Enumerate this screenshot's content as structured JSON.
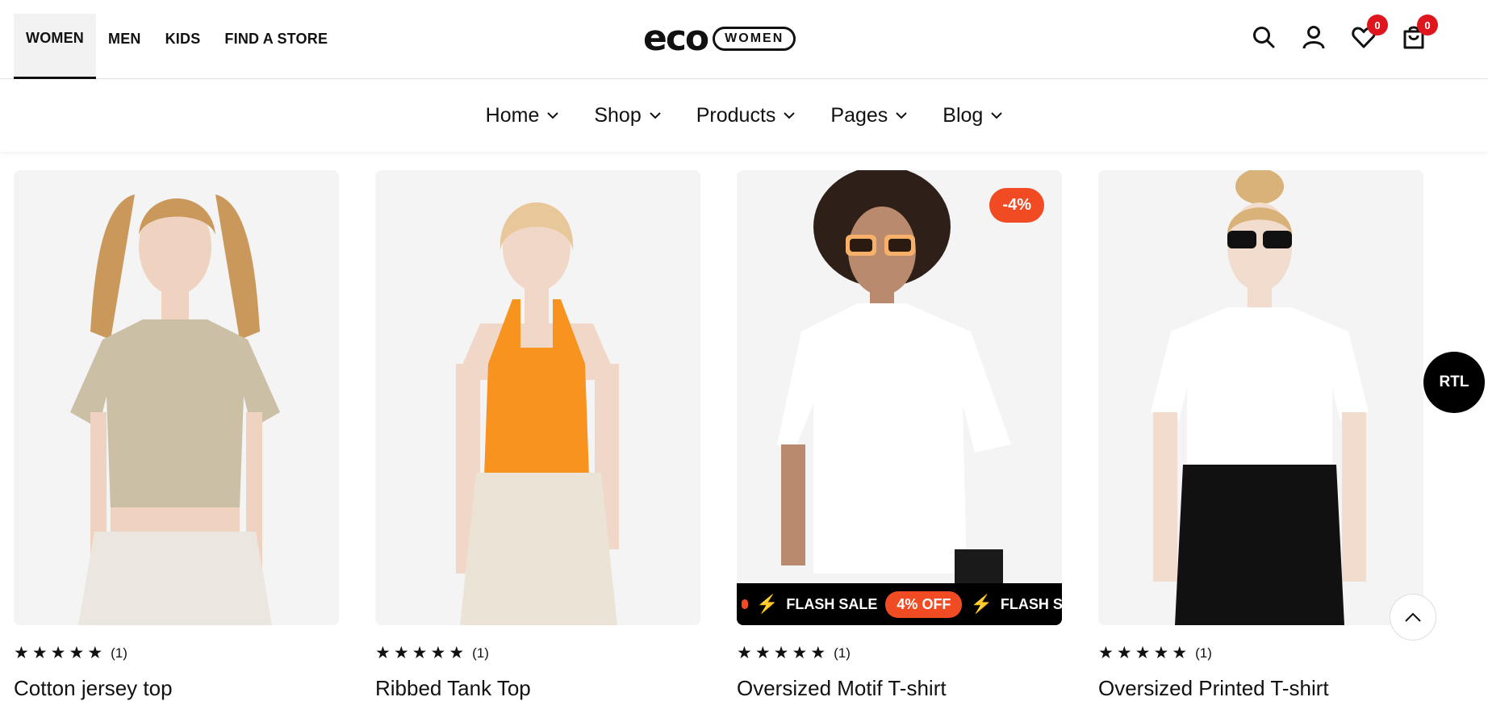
{
  "header": {
    "categories": [
      {
        "label": "WOMEN",
        "active": true
      },
      {
        "label": "MEN"
      },
      {
        "label": "KIDS"
      },
      {
        "label": "FIND A STORE"
      }
    ],
    "logo": {
      "text": "eco",
      "pill": "WOMEN"
    },
    "wishlist_count": "0",
    "cart_count": "0"
  },
  "nav": {
    "items": [
      "Home",
      "Shop",
      "Products",
      "Pages",
      "Blog"
    ]
  },
  "products": [
    {
      "name": "Cotton jersey top",
      "rating": 5,
      "reviews": "(1)",
      "shirt_color": "#cbbfa6",
      "pants_color": "#ebe7e0"
    },
    {
      "name": "Ribbed Tank Top",
      "rating": 5,
      "reviews": "(1)",
      "shirt_color": "#f7931e",
      "pants_color": "#ebe4d6"
    },
    {
      "name": "Oversized Motif T-shirt",
      "rating": 5,
      "reviews": "(1)",
      "discount": "-4%",
      "flash_label": "FLASH SALE",
      "flash_off": "4% OFF",
      "flash_label_repeat": "FLASH SAL",
      "shirt_color": "#ffffff",
      "pants_color": "#1a1a1a"
    },
    {
      "name": "Oversized Printed T-shirt",
      "rating": 5,
      "reviews": "(1)",
      "shirt_color": "#ffffff",
      "pants_color": "#111111"
    }
  ],
  "rtl_label": "RTL",
  "colors": {
    "accent": "#f04b23",
    "badge": "#e0161e",
    "dark": "#111111"
  }
}
